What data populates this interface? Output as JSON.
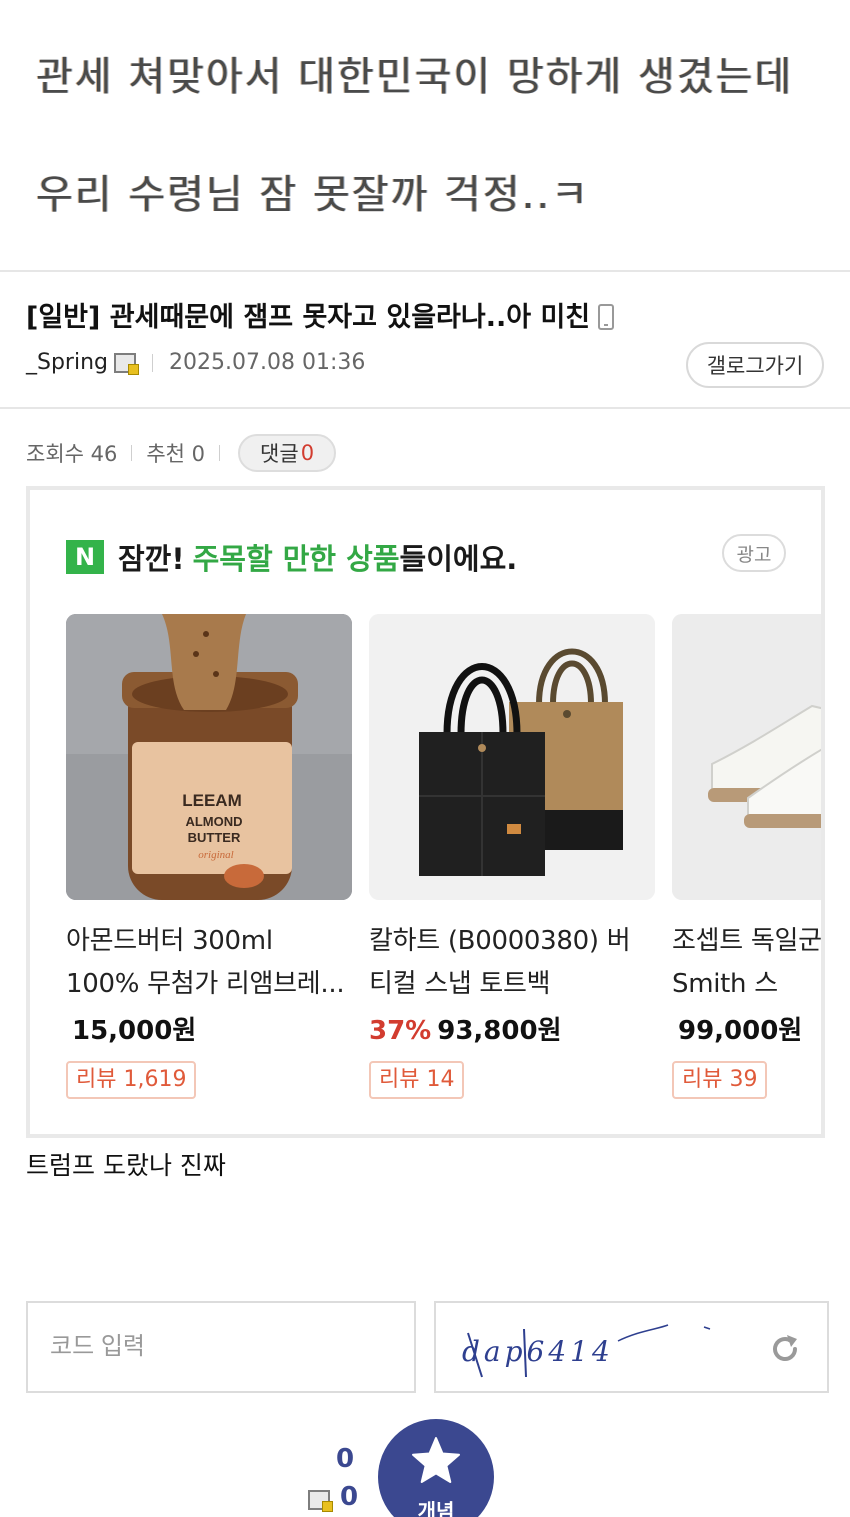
{
  "caption": {
    "line1": "관세 쳐맞아서 대한민국이 망하게 생겼는데",
    "line2": "우리 수령님 잠 못잘까 걱정..ㅋ"
  },
  "post": {
    "title": "[일반] 관세때문에 잼프 못자고 있을라나..아 미친",
    "author": "_Spring",
    "date": "2025.07.08 01:36",
    "gallery_button": "갤로그가기",
    "stats": {
      "views": "조회수 46",
      "recommend": "추천 0",
      "comment_label": "댓글",
      "comment_count": "0"
    },
    "body": "트럼프 도랐나 진짜"
  },
  "ad": {
    "logo": "N",
    "head_prefix": "잠깐!",
    "head_highlight": "주목할 만한 상품",
    "head_suffix": "들이에요.",
    "label": "광고",
    "products": [
      {
        "name": "아몬드버터 300ml 100% 무첨가 리앰브레...",
        "discount": "",
        "price": "15,000원",
        "review": "리뷰 1,619"
      },
      {
        "name": "칼하트 (B0000380) 버티컬 스냅 토트백",
        "discount": "37%",
        "price": "93,800원",
        "review": "리뷰 14"
      },
      {
        "name": "조셉트 독일군 스니커즈 Smith 스",
        "discount": "",
        "price": "99,000원",
        "review": "리뷰 39"
      }
    ],
    "jar_label": "LEEAM ALMOND BUTTER original"
  },
  "captcha": {
    "placeholder": "코드 입력",
    "text": "dap6414"
  },
  "vote": {
    "count_top": "0",
    "count_bottom": "0",
    "label": "개념"
  },
  "colors": {
    "accent_green": "#33a845",
    "accent_navy": "#3b4890",
    "accent_red": "#d23c2f"
  }
}
